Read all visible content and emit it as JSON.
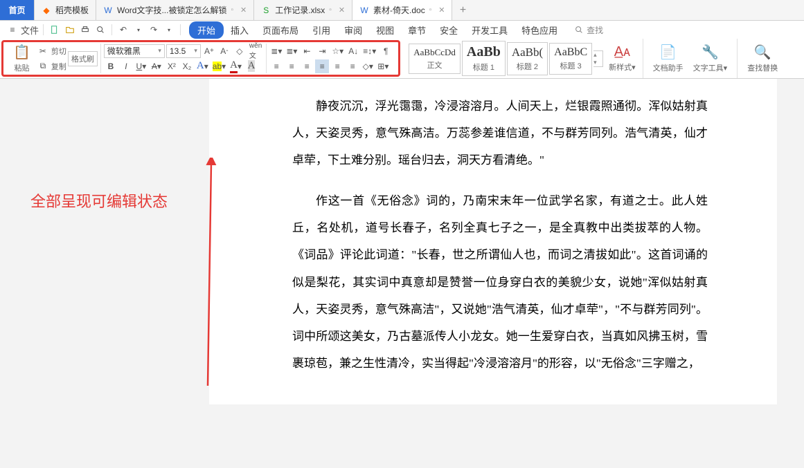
{
  "tabs": {
    "home": "首页",
    "docer": "稻壳模板",
    "word_locked": "Word文字技...被锁定怎么解锁",
    "xlsx": "工作记录.xlsx",
    "doc": "素材-倚天.doc"
  },
  "qa": {
    "file": "文件"
  },
  "menu": {
    "start": "开始",
    "insert": "插入",
    "layout": "页面布局",
    "ref": "引用",
    "review": "审阅",
    "view": "视图",
    "chapter": "章节",
    "security": "安全",
    "dev": "开发工具",
    "special": "特色应用",
    "search_ph": "查找"
  },
  "ribbon": {
    "paste": "粘贴",
    "cut": "剪切",
    "copy": "复制",
    "brush": "格式刷",
    "font_name": "微软雅黑",
    "font_size": "13.5",
    "styles": [
      {
        "preview": "AaBbCcDd",
        "name": "正文",
        "big": false
      },
      {
        "preview": "AaBb",
        "name": "标题 1",
        "big": true
      },
      {
        "preview": "AaBb(",
        "name": "标题 2",
        "big": false
      },
      {
        "preview": "AaBbC",
        "name": "标题 3",
        "big": false
      }
    ],
    "new_style": "新样式",
    "doc_helper": "文档助手",
    "text_tool": "文字工具",
    "find_replace": "查找替换"
  },
  "doc": {
    "p1": "静夜沉沉，浮光霭霭，冷浸溶溶月。人间天上，烂银霞照通彻。浑似姑射真人，天姿灵秀，意气殊高洁。万蕊参差谁信道，不与群芳同列。浩气清英，仙才卓荦，下土难分别。瑶台归去，洞天方看清绝。\"",
    "p2": "作这一首《无俗念》词的，乃南宋末年一位武学名家，有道之士。此人姓丘，名处机，道号长春子，名列全真七子之一，是全真教中出类拔萃的人物。《词品》评论此词道：\"长春，世之所谓仙人也，而词之清拔如此\"。这首词诵的似是梨花，其实词中真意却是赞誉一位身穿白衣的美貌少女，说她\"浑似姑射真人，天姿灵秀，意气殊高洁\"，又说她\"浩气清英，仙才卓荦\"，\"不与群芳同列\"。词中所颂这美女，乃古墓派传人小龙女。她一生爱穿白衣，当真如风拂玉树，雪裹琼苞，兼之生性清冷，实当得起\"冷浸溶溶月\"的形容，以\"无俗念\"三字赠之，"
  },
  "annotation": "全部呈现可编辑状态"
}
